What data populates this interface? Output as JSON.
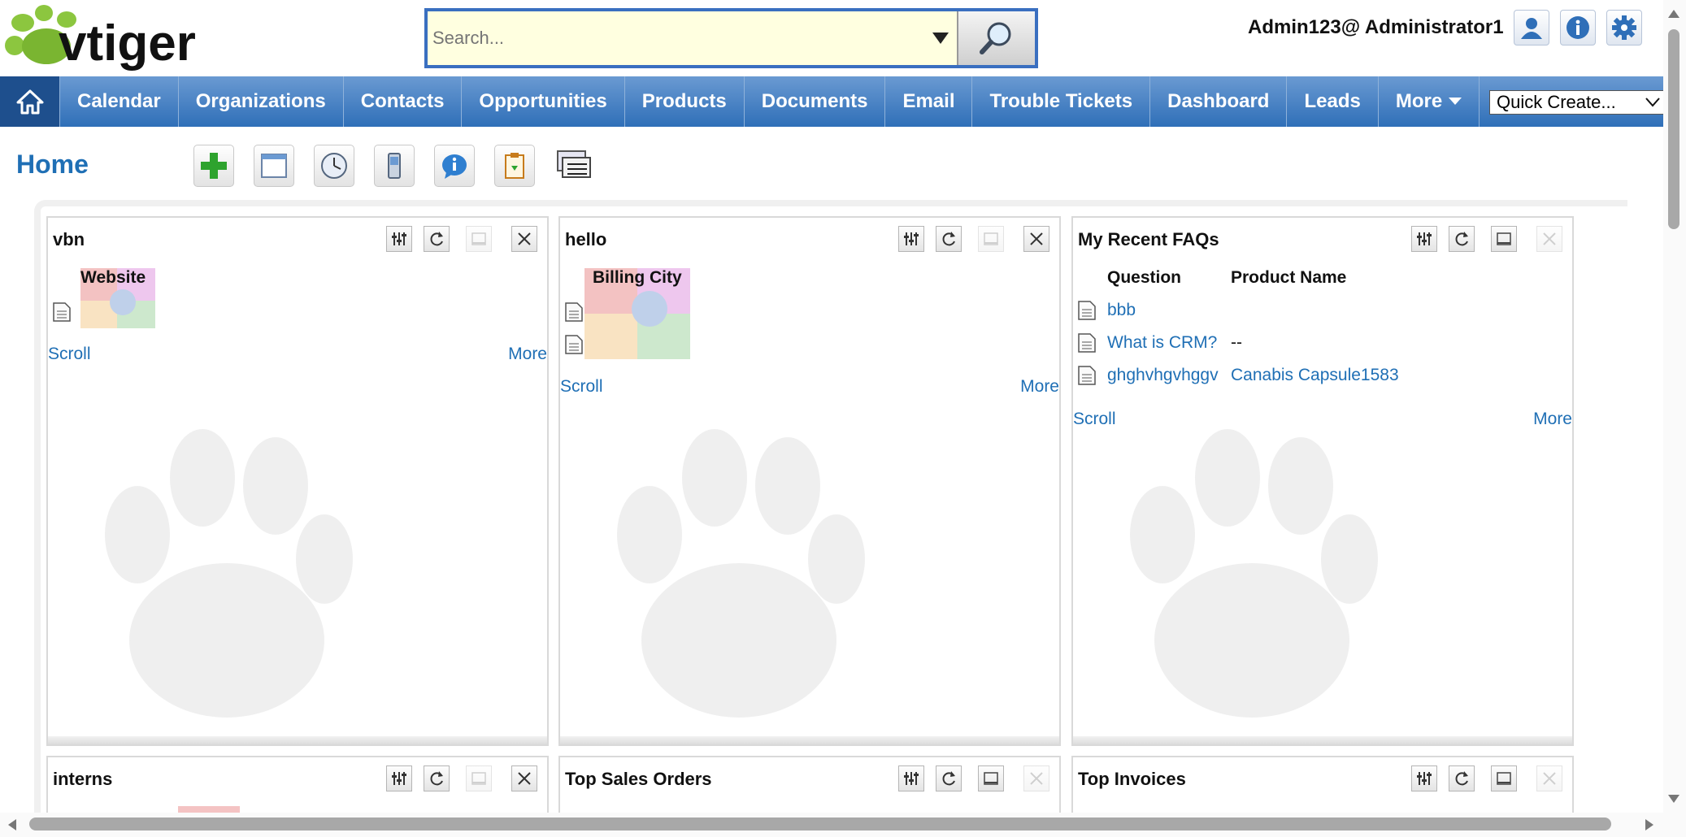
{
  "header": {
    "logo_text": "vtiger",
    "search_placeholder": "Search...",
    "user": "Admin123@ Administrator1"
  },
  "nav": {
    "items": [
      "Calendar",
      "Organizations",
      "Contacts",
      "Opportunities",
      "Products",
      "Documents",
      "Email",
      "Trouble Tickets",
      "Dashboard",
      "Leads",
      "More"
    ],
    "quick_create": "Quick Create..."
  },
  "page": {
    "title": "Home"
  },
  "widgets": [
    {
      "title": "vbn",
      "column": "Website",
      "scroll": "Scroll",
      "more": "More"
    },
    {
      "title": "hello",
      "column": "Billing City",
      "scroll": "Scroll",
      "more": "More"
    },
    {
      "title": "My Recent FAQs",
      "columns": [
        "Question",
        "Product Name"
      ],
      "rows": [
        {
          "question": "bbb",
          "product": ""
        },
        {
          "question": "What is CRM?",
          "product": "--"
        },
        {
          "question": "ghghvhgvhggv",
          "product": "Canabis Capsule1583"
        }
      ],
      "scroll": "Scroll",
      "more": "More"
    },
    {
      "title": "interns"
    },
    {
      "title": "Top Sales Orders"
    },
    {
      "title": "Top Invoices"
    }
  ],
  "colors": {
    "nav_blue": "#2f6fb8",
    "link_blue": "#1f6fb5",
    "title_blue": "#1f6fb5",
    "logo_green": "#7fba00"
  }
}
